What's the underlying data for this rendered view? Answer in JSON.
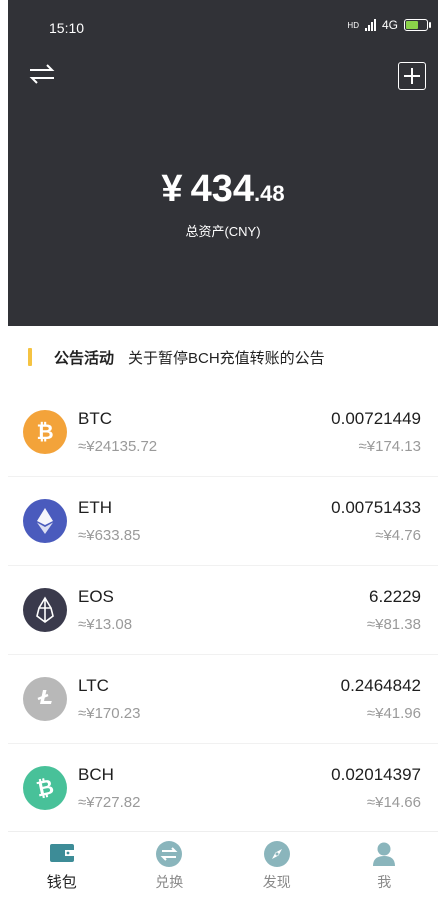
{
  "status": {
    "time": "15:10",
    "network": "4G",
    "hd": "HD"
  },
  "header": {
    "total_currency": "¥",
    "total_integer": "434",
    "total_decimal": ".48",
    "total_label": "总资产(CNY)"
  },
  "notice": {
    "tag": "公告活动",
    "text": "关于暂停BCH充值转账的公告"
  },
  "coins": [
    {
      "name": "BTC",
      "price": "≈¥24135.72",
      "amount": "0.00721449",
      "value": "≈¥174.13",
      "color": "#f3a33a",
      "icon": "bitcoin-icon"
    },
    {
      "name": "ETH",
      "price": "≈¥633.85",
      "amount": "0.00751433",
      "value": "≈¥4.76",
      "color": "#4a5bbd",
      "icon": "ethereum-icon"
    },
    {
      "name": "EOS",
      "price": "≈¥13.08",
      "amount": "6.2229",
      "value": "≈¥81.38",
      "color": "#3a3a4c",
      "icon": "eos-icon"
    },
    {
      "name": "LTC",
      "price": "≈¥170.23",
      "amount": "0.2464842",
      "value": "≈¥41.96",
      "color": "#b8b8b8",
      "icon": "litecoin-icon"
    },
    {
      "name": "BCH",
      "price": "≈¥727.82",
      "amount": "0.02014397",
      "value": "≈¥14.66",
      "color": "#48c199",
      "icon": "bitcoin-cash-icon"
    }
  ],
  "tabs": [
    {
      "label": "钱包",
      "icon": "wallet-icon",
      "active": true
    },
    {
      "label": "兑换",
      "icon": "exchange-icon",
      "active": false
    },
    {
      "label": "发现",
      "icon": "compass-icon",
      "active": false
    },
    {
      "label": "我",
      "icon": "profile-icon",
      "active": false
    }
  ],
  "colors": {
    "header_bg": "#313237",
    "accent": "#3d8c97",
    "tab_inactive": "#8ab5bc",
    "notice_bar": "#f5c342"
  }
}
